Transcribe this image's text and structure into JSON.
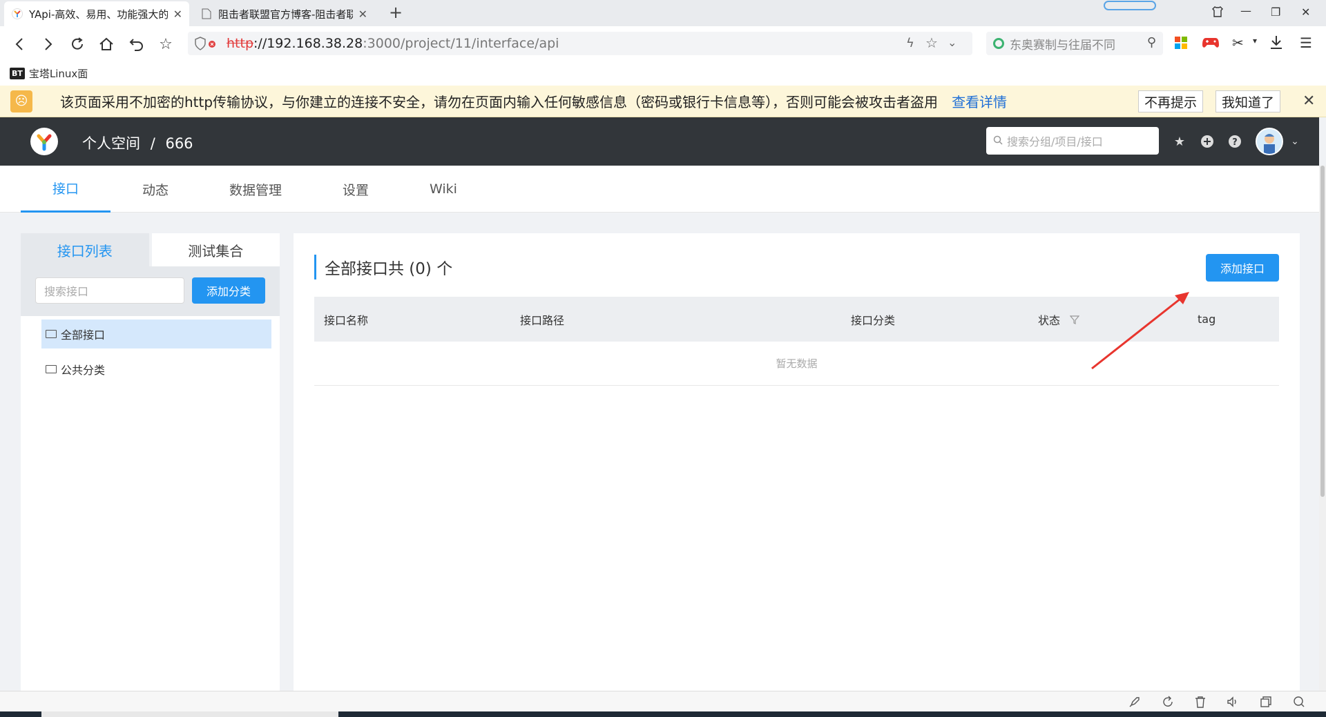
{
  "browser": {
    "tabs": [
      {
        "title": "YApi-高效、易用、功能强大的",
        "active": true
      },
      {
        "title": "阻击者联盟官方博客-阻击者联",
        "active": false
      }
    ],
    "url": {
      "scheme": "http",
      "host": "://192.168.38.28",
      "rest": ":3000/project/11/interface/api"
    },
    "search_placeholder": "东奥赛制与往届不同",
    "bookmark": {
      "badge": "BT",
      "label": "宝塔Linux面"
    }
  },
  "warning": {
    "text": "该页面采用不加密的http传输协议，与你建立的连接不安全，请勿在页面内输入任何敏感信息（密码或银行卡信息等），否则可能会被攻击者盗用",
    "link": "查看详情",
    "btn_never": "不再提示",
    "btn_ok": "我知道了"
  },
  "header": {
    "space": "个人空间",
    "sep": "/",
    "project": "666",
    "search_placeholder": "搜索分组/项目/接口"
  },
  "subnav": {
    "tabs": [
      {
        "label": "接口",
        "active": true
      },
      {
        "label": "动态",
        "active": false
      },
      {
        "label": "数据管理",
        "active": false
      },
      {
        "label": "设置",
        "active": false
      },
      {
        "label": "Wiki",
        "active": false
      }
    ]
  },
  "left": {
    "tab_list": "接口列表",
    "tab_tests": "测试集合",
    "search_placeholder": "搜索接口",
    "add_category": "添加分类",
    "items": [
      "全部接口",
      "公共分类"
    ]
  },
  "main": {
    "title": "全部接口共 (0) 个",
    "add_interface": "添加接口",
    "columns": [
      "接口名称",
      "接口路径",
      "接口分类",
      "状态",
      "tag"
    ],
    "empty": "暂无数据"
  },
  "colors": {
    "accent": "#2395f1",
    "header_bg": "#32363a",
    "arrow": "#e8352e"
  }
}
